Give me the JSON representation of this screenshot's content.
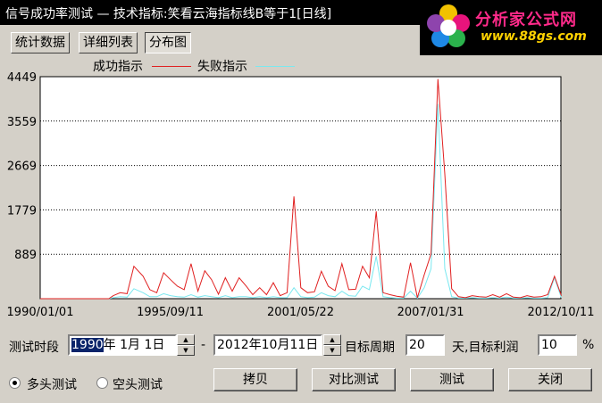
{
  "window": {
    "title": "信号成功率测试 — 技术指标:笑看云海指标线B等于1[日线]"
  },
  "logo": {
    "name": "分析家公式网",
    "url": "www.88gs.com"
  },
  "tabs": [
    {
      "label": "统计数据",
      "active": false
    },
    {
      "label": "详细列表",
      "active": false
    },
    {
      "label": "分布图",
      "active": true
    }
  ],
  "chart_data": {
    "type": "line",
    "title": "",
    "xlabel": "",
    "ylabel": "",
    "ylim": [
      0,
      4449
    ],
    "yticks": [
      "4449",
      "3559",
      "2669",
      "1779",
      "889"
    ],
    "xticks": [
      "1990/01/01",
      "1995/09/11",
      "2001/05/22",
      "2007/01/31",
      "2012/10/11"
    ],
    "grid": true,
    "legend_position": "top",
    "x": [
      1990.0,
      1990.5,
      1991.0,
      1991.5,
      1992.0,
      1992.5,
      1993.0,
      1993.2,
      1993.5,
      1993.8,
      1994.1,
      1994.5,
      1994.8,
      1995.1,
      1995.4,
      1995.7,
      1996.0,
      1996.3,
      1996.6,
      1996.9,
      1997.2,
      1997.5,
      1997.8,
      1998.1,
      1998.4,
      1998.7,
      1999.0,
      1999.3,
      1999.6,
      1999.9,
      2000.2,
      2000.5,
      2000.8,
      2001.1,
      2001.4,
      2001.7,
      2002.0,
      2002.3,
      2002.6,
      2002.9,
      2003.2,
      2003.5,
      2003.8,
      2004.1,
      2004.4,
      2004.7,
      2005.0,
      2005.3,
      2005.6,
      2005.9,
      2006.2,
      2006.5,
      2006.8,
      2007.1,
      2007.4,
      2007.7,
      2008.0,
      2008.3,
      2008.6,
      2008.9,
      2009.2,
      2009.5,
      2009.8,
      2010.1,
      2010.4,
      2010.7,
      2011.0,
      2011.3,
      2011.6,
      2011.9,
      2012.2,
      2012.5,
      2012.8
    ],
    "series": [
      {
        "name": "成功指示",
        "color": "#e02020",
        "values": [
          0,
          0,
          0,
          0,
          0,
          0,
          0,
          60,
          120,
          100,
          650,
          450,
          180,
          120,
          520,
          380,
          250,
          180,
          700,
          150,
          560,
          380,
          90,
          420,
          150,
          420,
          260,
          80,
          220,
          80,
          320,
          60,
          120,
          2050,
          220,
          120,
          140,
          550,
          250,
          160,
          700,
          180,
          190,
          650,
          420,
          1750,
          120,
          80,
          50,
          30,
          720,
          20,
          480,
          900,
          4400,
          2500,
          200,
          40,
          20,
          60,
          40,
          30,
          80,
          30,
          100,
          30,
          20,
          60,
          30,
          40,
          80,
          450,
          60
        ]
      },
      {
        "name": "失败指示",
        "color": "#7ae8f0",
        "values": [
          0,
          0,
          0,
          0,
          0,
          0,
          0,
          20,
          40,
          30,
          200,
          120,
          40,
          40,
          100,
          60,
          40,
          30,
          80,
          30,
          60,
          40,
          20,
          60,
          20,
          40,
          40,
          20,
          40,
          20,
          40,
          20,
          20,
          220,
          40,
          20,
          30,
          120,
          60,
          40,
          150,
          60,
          50,
          250,
          180,
          850,
          40,
          20,
          10,
          10,
          150,
          10,
          220,
          600,
          3900,
          600,
          40,
          10,
          10,
          20,
          10,
          10,
          20,
          10,
          30,
          10,
          10,
          20,
          10,
          10,
          20,
          420,
          20
        ]
      }
    ]
  },
  "controls": {
    "period_label": "测试时段",
    "start_date_year": "1990",
    "start_date_rest": "年  1月  1日",
    "dash": "-",
    "end_date": "2012年10月11日",
    "target_period_label": "目标周期",
    "target_period_value": "20",
    "target_profit_label": "天,目标利润",
    "target_profit_value": "10",
    "percent": "%"
  },
  "radios": {
    "long_label": "多头测试",
    "short_label": "空头测试"
  },
  "buttons": {
    "copy": "拷贝",
    "compare": "对比测试",
    "test": "测试",
    "close": "关闭"
  }
}
